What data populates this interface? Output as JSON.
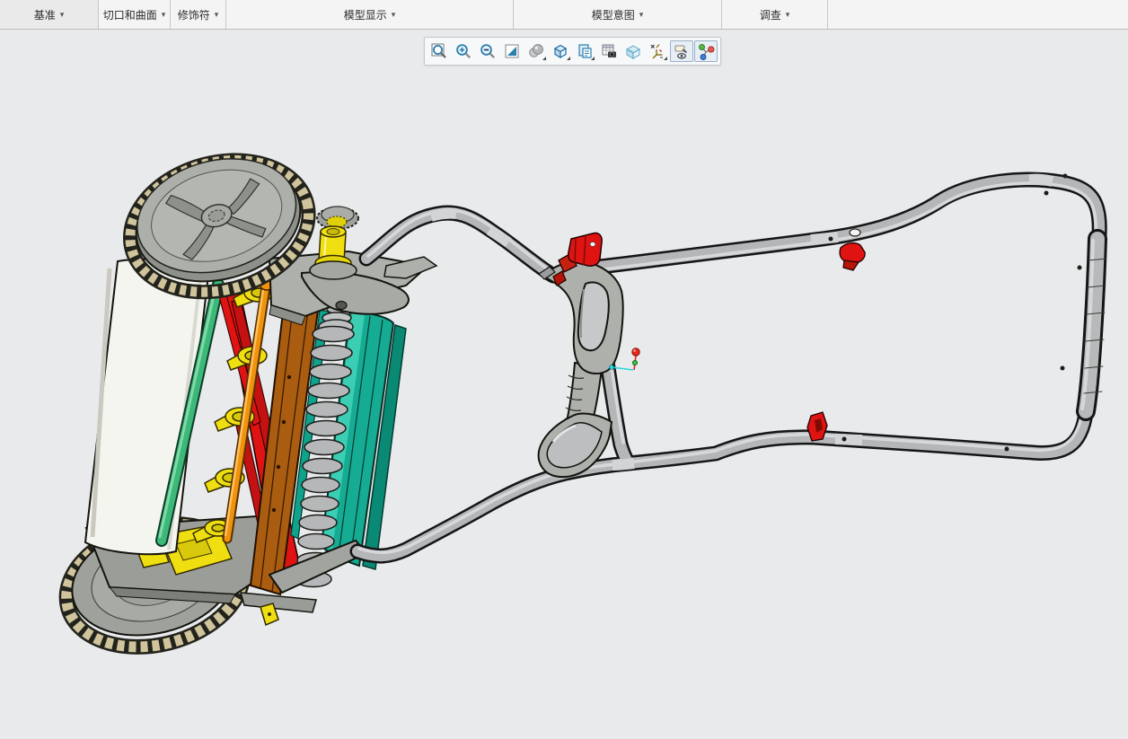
{
  "ribbon": {
    "dropdown_glyph": "▾",
    "tabs": [
      {
        "label": "基准"
      },
      {
        "label": "切口和曲面"
      },
      {
        "label": "修饰符"
      },
      {
        "label": "模型显示"
      },
      {
        "label": "模型意图"
      },
      {
        "label": "调查"
      }
    ]
  },
  "toolbar": {
    "buttons": [
      {
        "name": "zoom-to-fit",
        "pressed": false,
        "dropdown": false
      },
      {
        "name": "zoom-in",
        "pressed": false,
        "dropdown": false
      },
      {
        "name": "zoom-out",
        "pressed": false,
        "dropdown": false
      },
      {
        "name": "repaint",
        "pressed": false,
        "dropdown": false
      },
      {
        "name": "shading-style",
        "pressed": false,
        "dropdown": true
      },
      {
        "name": "display-style",
        "pressed": false,
        "dropdown": true
      },
      {
        "name": "saved-view-list",
        "pressed": false,
        "dropdown": true
      },
      {
        "name": "view-capture",
        "pressed": false,
        "dropdown": false
      },
      {
        "name": "view-manager",
        "pressed": false,
        "dropdown": false
      },
      {
        "name": "datum-display-filters",
        "pressed": false,
        "dropdown": true
      },
      {
        "name": "annotation-display",
        "pressed": true,
        "dropdown": false
      },
      {
        "name": "spin-center",
        "pressed": true,
        "dropdown": false
      }
    ]
  },
  "canvas": {
    "description": "3D shaded assembly of a push reel lawn mower: two tan-treaded drive wheels, white front roller, red/teal/yellow/orange reel cutting assembly with silver coil spring, gray tubular loop handle with red cam clamps, spin-center triad marker at model origin"
  },
  "colors": {
    "canvas-bg": "#e8eaec",
    "ribbon-bg": "#f4f4f4",
    "ribbon-border": "#c9c9c9",
    "ribbon-text": "#2b2b2b",
    "toolbar-bg": "#f7f8f9",
    "toolbar-border": "#c6c8ca",
    "pressed-bg": "#e8eef5",
    "pressed-border": "#9ab0c6",
    "tube": "#b4b6b8",
    "tube-outline": "#151515",
    "tube-hi": "#dcdee0",
    "steel": "#aeb0ac",
    "steel-dark": "#8e908a",
    "white-part": "#f5f5f0",
    "tread-tan": "#cfc49c",
    "tread-dark": "#23231d",
    "teal": "#16ab93",
    "teal-light": "#3fd2b8",
    "teal-dark": "#0a8a74",
    "green": "#3cb878",
    "red": "#e01313",
    "red-dark": "#8c1106",
    "yellow": "#f0df10",
    "orange": "#f0930c",
    "brown": "#aa5c10",
    "spring": "#b5b7b9",
    "marker-red": "#e8281c",
    "marker-green": "#35c040",
    "marker-cyan": "#28d8e0",
    "icon-blue": "#2a7fae",
    "icon-gold": "#8a6d10"
  }
}
